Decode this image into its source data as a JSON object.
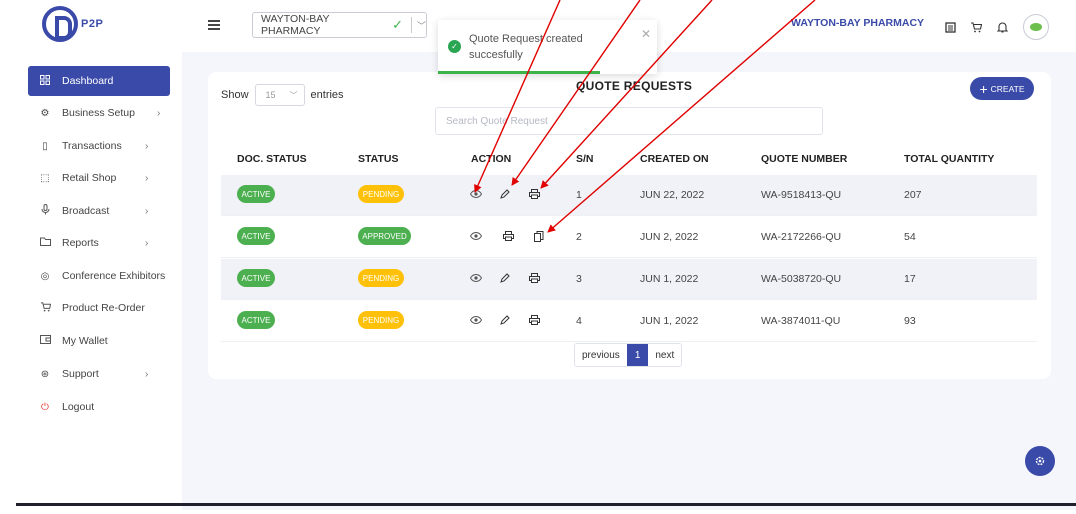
{
  "brand": {
    "logo_text": "P2P"
  },
  "header": {
    "pharmacy_select_value": "WAYTON-BAY PHARMACY",
    "pharmacy_name": "WAYTON-BAY PHARMACY"
  },
  "toast": {
    "message": "Quote Request created succesfully"
  },
  "sidebar": {
    "items": [
      {
        "label": "Dashboard",
        "icon": "grid-icon",
        "active": true
      },
      {
        "label": "Business Setup",
        "icon": "gear-icon",
        "has_chevron": true
      },
      {
        "label": "Transactions",
        "icon": "document-icon",
        "has_chevron": true
      },
      {
        "label": "Retail Shop",
        "icon": "shop-icon",
        "has_chevron": true
      },
      {
        "label": "Broadcast",
        "icon": "microphone-icon",
        "has_chevron": true
      },
      {
        "label": "Reports",
        "icon": "folder-icon",
        "has_chevron": true
      },
      {
        "label": "Conference Exhibitors",
        "icon": "target-icon"
      },
      {
        "label": "Product Re-Order",
        "icon": "cart-icon"
      },
      {
        "label": "My Wallet",
        "icon": "wallet-icon"
      },
      {
        "label": "Support",
        "icon": "support-icon",
        "has_chevron": true
      },
      {
        "label": "Logout",
        "icon": "power-icon"
      }
    ]
  },
  "main": {
    "show_label": "Show",
    "entries_value": "15",
    "entries_label": "entries",
    "title": "QUOTE REQUESTS",
    "create_label": "CREATE",
    "search_placeholder": "Search Quote Request",
    "columns": [
      "DOC. STATUS",
      "STATUS",
      "ACTION",
      "S/N",
      "CREATED ON",
      "QUOTE NUMBER",
      "TOTAL QUANTITY"
    ],
    "rows": [
      {
        "doc_status": "ACTIVE",
        "status": "PENDING",
        "actions": [
          "eye-icon",
          "pencil-icon",
          "printer-icon"
        ],
        "sn": "1",
        "created_on": "JUN 22, 2022",
        "quote_number": "WA-9518413-QU",
        "total_quantity": "207"
      },
      {
        "doc_status": "ACTIVE",
        "status": "APPROVED",
        "actions": [
          "eye-icon",
          "printer-icon",
          "copy-icon"
        ],
        "sn": "2",
        "created_on": "JUN 2, 2022",
        "quote_number": "WA-2172266-QU",
        "total_quantity": "54"
      },
      {
        "doc_status": "ACTIVE",
        "status": "PENDING",
        "actions": [
          "eye-icon",
          "pencil-icon",
          "printer-icon"
        ],
        "sn": "3",
        "created_on": "JUN 1, 2022",
        "quote_number": "WA-5038720-QU",
        "total_quantity": "17"
      },
      {
        "doc_status": "ACTIVE",
        "status": "PENDING",
        "actions": [
          "eye-icon",
          "pencil-icon",
          "printer-icon"
        ],
        "sn": "4",
        "created_on": "JUN 1, 2022",
        "quote_number": "WA-3874011-QU",
        "total_quantity": "93"
      }
    ],
    "pagination": {
      "previous": "previous",
      "current": "1",
      "next": "next"
    }
  },
  "colors": {
    "primary": "#3a4aa8",
    "success": "#4caf50",
    "warning": "#ffc107",
    "annotation": "#e00000"
  }
}
